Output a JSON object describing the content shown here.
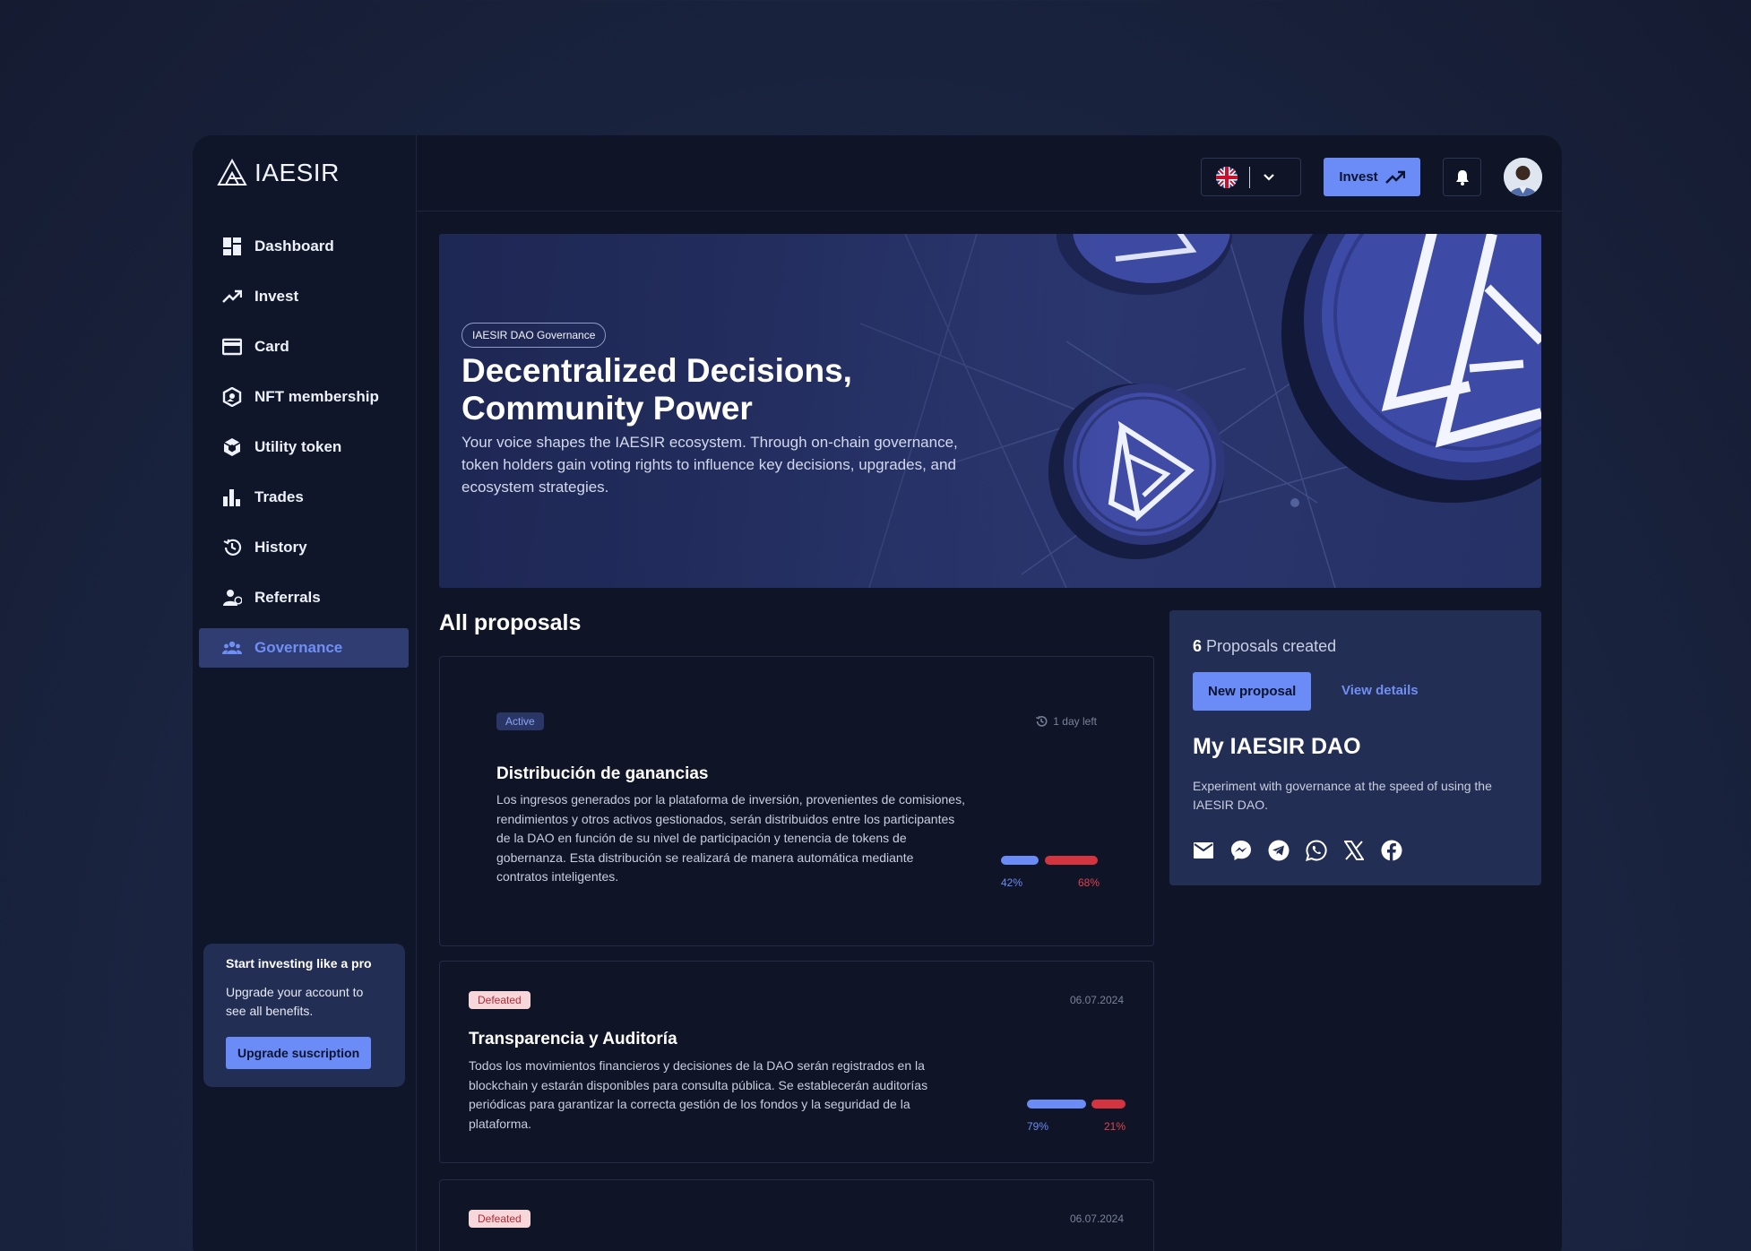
{
  "brand": {
    "name": "IAESIR"
  },
  "sidebar": {
    "items": [
      {
        "label": "Dashboard",
        "icon": "dashboard-icon"
      },
      {
        "label": "Invest",
        "icon": "trending-up-icon"
      },
      {
        "label": "Card",
        "icon": "card-icon"
      },
      {
        "label": "NFT membership",
        "icon": "nft-icon"
      },
      {
        "label": "Utility token",
        "icon": "token-icon"
      },
      {
        "label": "Trades",
        "icon": "bar-chart-icon"
      },
      {
        "label": "History",
        "icon": "history-icon"
      },
      {
        "label": "Referrals",
        "icon": "referrals-icon"
      },
      {
        "label": "Governance",
        "icon": "governance-icon",
        "active": true
      }
    ],
    "promo": {
      "title": "Start investing like a pro",
      "text": "Upgrade your account to see all benefits.",
      "button": "Upgrade suscription"
    }
  },
  "header": {
    "language": "UK flag",
    "invest_label": "Invest"
  },
  "hero": {
    "tag": "IAESIR DAO Governance",
    "title": "Decentralized Decisions, Community Power",
    "description": "Your voice shapes the IAESIR ecosystem. Through on-chain governance, token holders gain voting rights to influence key decisions, upgrades, and ecosystem strategies."
  },
  "proposals": {
    "title": "All proposals",
    "items": [
      {
        "status": "Active",
        "meta": "1 day left",
        "title": "Distribución de ganancias",
        "description": "Los ingresos generados por la plataforma de inversión, provenientes de comisiones, rendimientos y otros activos gestionados, serán distribuidos entre los participantes de la DAO en función de su nivel de participación y tenencia de tokens de gobernanza. Esta distribución se realizará de manera automática mediante contratos inteligentes.",
        "for_pct": "42%",
        "against_pct": "68%",
        "for_value": 42,
        "against_value": 68
      },
      {
        "status": "Defeated",
        "meta": "06.07.2024",
        "title": "Transparencia y Auditoría",
        "description": "Todos los movimientos financieros y decisiones de la DAO serán registrados en la blockchain y estarán disponibles para consulta pública. Se establecerán auditorías periódicas para garantizar la correcta gestión de los fondos y la seguridad de la plataforma.",
        "for_pct": "79%",
        "against_pct": "21%",
        "for_value": 79,
        "against_value": 21
      },
      {
        "status": "Defeated",
        "meta": "06.07.2024"
      }
    ]
  },
  "panel": {
    "count": "6",
    "count_label": "Proposals created",
    "new_button": "New proposal",
    "view_link": "View details",
    "title": "My IAESIR DAO",
    "description": "Experiment with governance at the speed of using the IAESIR DAO.",
    "share_icons": [
      "mail-icon",
      "messenger-icon",
      "telegram-icon",
      "whatsapp-icon",
      "x-icon",
      "facebook-icon"
    ]
  },
  "colors": {
    "accent": "#6b8cf6",
    "danger": "#d3343f",
    "background": "#0f1526",
    "panel": "#232e55"
  }
}
